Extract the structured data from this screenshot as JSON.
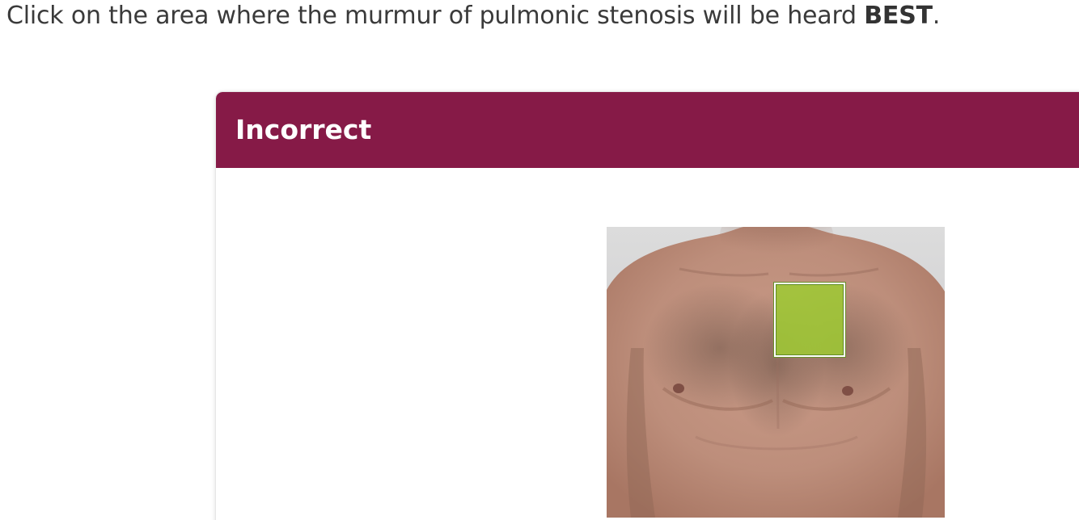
{
  "question": {
    "prefix": "Click on the area where the murmur of pulmonic stenosis will be heard ",
    "emphasis": "BEST",
    "suffix": "."
  },
  "feedback": {
    "title": "Incorrect",
    "header_color": "#861a47"
  },
  "figure": {
    "subject": "anterior chest photograph",
    "hotspot_color": "#9ec834"
  }
}
